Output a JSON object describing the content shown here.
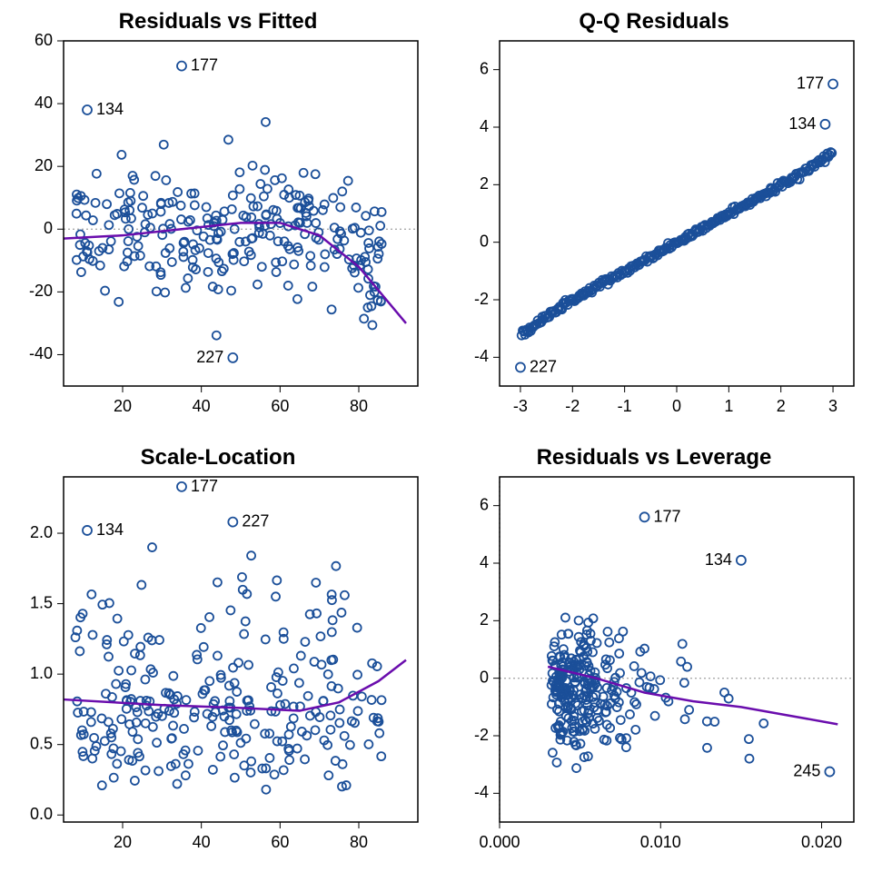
{
  "chart_data": [
    {
      "id": "residfit",
      "type": "scatter",
      "title": "Residuals vs Fitted",
      "xlim": [
        5,
        95
      ],
      "ylim": [
        -50,
        60
      ],
      "xticks": [
        20,
        40,
        60,
        80
      ],
      "yticks": [
        -40,
        -20,
        0,
        20,
        40,
        60
      ],
      "hline": 0,
      "smooth": [
        [
          5,
          -3
        ],
        [
          20,
          -2
        ],
        [
          35,
          0
        ],
        [
          50,
          2
        ],
        [
          60,
          2
        ],
        [
          70,
          -2
        ],
        [
          80,
          -12
        ],
        [
          92,
          -30
        ]
      ],
      "outliers": [
        {
          "label": "177",
          "x": 35,
          "y": 52,
          "side": "right"
        },
        {
          "label": "134",
          "x": 11,
          "y": 38,
          "side": "right"
        },
        {
          "label": "227",
          "x": 48,
          "y": -41,
          "side": "left"
        }
      ],
      "scatter_seed": 1,
      "scatter_n": 270
    },
    {
      "id": "qq",
      "type": "scatter",
      "title": "Q-Q Residuals",
      "xlim": [
        -3.4,
        3.4
      ],
      "ylim": [
        -5,
        7
      ],
      "xticks": [
        -3,
        -2,
        -1,
        0,
        1,
        2,
        3
      ],
      "yticks": [
        -4,
        -2,
        0,
        2,
        4,
        6
      ],
      "refline_pts": [
        [
          -3,
          -3
        ],
        [
          3,
          3
        ]
      ],
      "outliers": [
        {
          "label": "177",
          "x": 3.0,
          "y": 5.5,
          "side": "left"
        },
        {
          "label": "134",
          "x": 2.85,
          "y": 4.1,
          "side": "left"
        },
        {
          "label": "227",
          "x": -3.0,
          "y": -4.35,
          "side": "right"
        }
      ],
      "scatter_seed": 2,
      "scatter_n": 270
    },
    {
      "id": "scaleloc",
      "type": "scatter",
      "title": "Scale-Location",
      "xlim": [
        5,
        95
      ],
      "ylim": [
        -0.05,
        2.4
      ],
      "xticks": [
        20,
        40,
        60,
        80
      ],
      "yticks": [
        0.0,
        0.5,
        1.0,
        1.5,
        2.0
      ],
      "smooth": [
        [
          5,
          0.82
        ],
        [
          30,
          0.78
        ],
        [
          50,
          0.76
        ],
        [
          65,
          0.74
        ],
        [
          75,
          0.8
        ],
        [
          85,
          0.95
        ],
        [
          92,
          1.1
        ]
      ],
      "outliers": [
        {
          "label": "177",
          "x": 35,
          "y": 2.33,
          "side": "right"
        },
        {
          "label": "134",
          "x": 11,
          "y": 2.02,
          "side": "right"
        },
        {
          "label": "227",
          "x": 48,
          "y": 2.08,
          "side": "right"
        }
      ],
      "scatter_seed": 3,
      "scatter_n": 270
    },
    {
      "id": "leverage",
      "type": "scatter",
      "title": "Residuals vs Leverage",
      "xlim": [
        0.0,
        0.022
      ],
      "ylim": [
        -5,
        7
      ],
      "xticks": [
        0.0,
        0.01,
        0.02
      ],
      "yticks": [
        -4,
        -2,
        0,
        2,
        4,
        6
      ],
      "hline": 0,
      "vline": 0.0,
      "smooth": [
        [
          0.003,
          0.4
        ],
        [
          0.006,
          0
        ],
        [
          0.009,
          -0.5
        ],
        [
          0.012,
          -0.8
        ],
        [
          0.015,
          -1.0
        ],
        [
          0.018,
          -1.3
        ],
        [
          0.021,
          -1.6
        ]
      ],
      "outliers": [
        {
          "label": "177",
          "x": 0.009,
          "y": 5.6,
          "side": "right"
        },
        {
          "label": "134",
          "x": 0.015,
          "y": 4.1,
          "side": "left"
        },
        {
          "label": "245",
          "x": 0.0205,
          "y": -3.25,
          "side": "left"
        }
      ],
      "scatter_seed": 4,
      "scatter_n": 270
    }
  ]
}
